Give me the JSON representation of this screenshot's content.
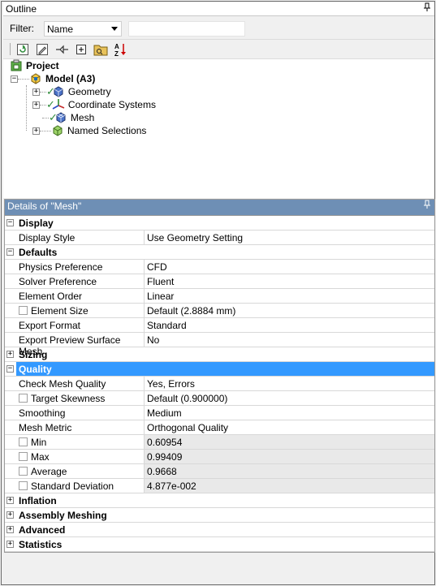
{
  "outline": {
    "title": "Outline",
    "pin_icon": "pin-icon"
  },
  "filter": {
    "label": "Filter:",
    "selected": "Name",
    "search_value": ""
  },
  "toolbar": {
    "buttons": [
      "refresh-icon",
      "edit-icon",
      "tag-icon",
      "expand-all-icon",
      "folder-icon",
      "sort-az-icon"
    ]
  },
  "tree": {
    "project": "Project",
    "model": "Model (A3)",
    "children": [
      {
        "label": "Geometry",
        "expandable": true,
        "checked": true
      },
      {
        "label": "Coordinate Systems",
        "expandable": true,
        "checked": true
      },
      {
        "label": "Mesh",
        "expandable": false,
        "checked": true
      },
      {
        "label": "Named Selections",
        "expandable": true,
        "checked": false
      }
    ]
  },
  "details": {
    "title": "Details of \"Mesh\"",
    "pin_icon": "pin-icon",
    "sections": {
      "display": "Display",
      "defaults": "Defaults",
      "sizing": "Sizing",
      "quality": "Quality",
      "inflation": "Inflation",
      "assembly": "Assembly Meshing",
      "advanced": "Advanced",
      "statistics": "Statistics"
    },
    "rows": {
      "display_style": {
        "label": "Display Style",
        "value": "Use Geometry Setting"
      },
      "physics": {
        "label": "Physics Preference",
        "value": "CFD"
      },
      "solver": {
        "label": "Solver Preference",
        "value": "Fluent"
      },
      "order": {
        "label": "Element Order",
        "value": "Linear"
      },
      "size": {
        "label": "Element Size",
        "value": "Default (2.8884 mm)"
      },
      "export_format": {
        "label": "Export Format",
        "value": "Standard"
      },
      "export_preview": {
        "label": "Export Preview Surface Mesh",
        "value": "No"
      },
      "check_quality": {
        "label": "Check Mesh Quality",
        "value": "Yes, Errors"
      },
      "target_skew": {
        "label": "Target Skewness",
        "value": "Default (0.900000)"
      },
      "smoothing": {
        "label": "Smoothing",
        "value": "Medium"
      },
      "metric": {
        "label": "Mesh Metric",
        "value": "Orthogonal Quality"
      },
      "min": {
        "label": "Min",
        "value": "0.60954"
      },
      "max": {
        "label": "Max",
        "value": "0.99409"
      },
      "average": {
        "label": "Average",
        "value": "0.9668"
      },
      "stddev": {
        "label": "Standard Deviation",
        "value": "4.877e-002"
      }
    }
  },
  "colors": {
    "selection": "#3399ff",
    "details_header": "#6e8fb5",
    "readonly_bg": "#e9e9e9",
    "check_green": "#2e8b3a"
  }
}
